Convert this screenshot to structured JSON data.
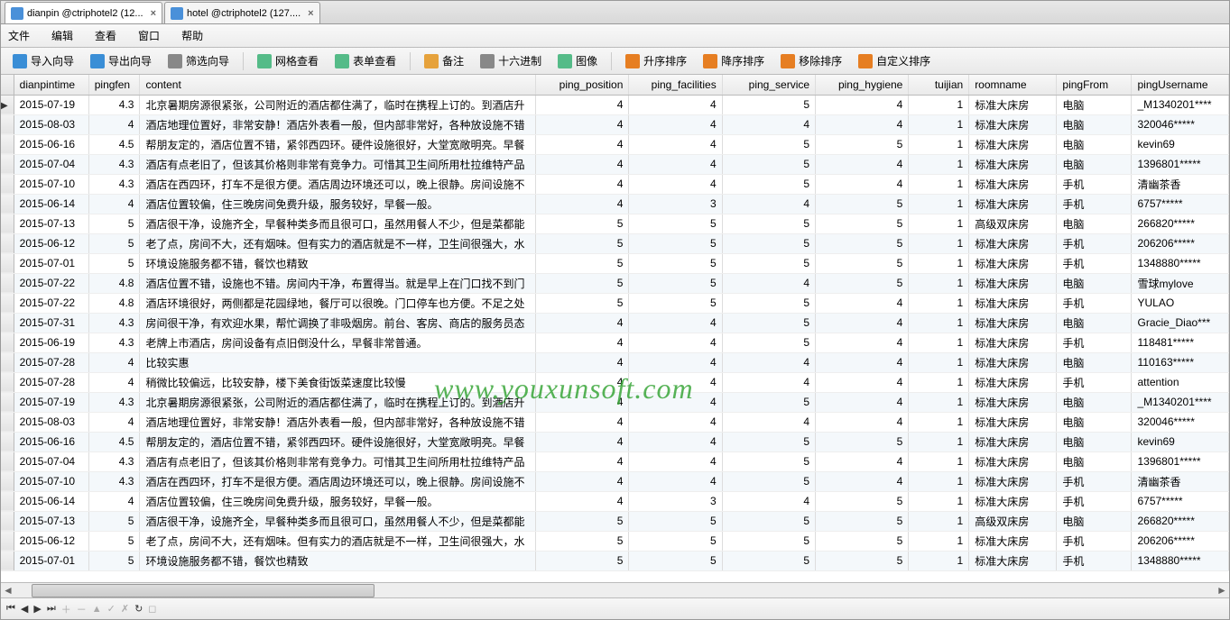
{
  "tabs": [
    {
      "label": "dianpin @ctriphotel2 (12...",
      "active": true
    },
    {
      "label": "hotel @ctriphotel2 (127....",
      "active": false
    }
  ],
  "menu": {
    "file": "文件",
    "edit": "编辑",
    "view": "查看",
    "window": "窗口",
    "help": "帮助"
  },
  "toolbar": {
    "import": "导入向导",
    "export": "导出向导",
    "filter": "筛选向导",
    "grid": "网格查看",
    "form": "表单查看",
    "memo": "备注",
    "hex": "十六进制",
    "image": "图像",
    "asc": "升序排序",
    "desc": "降序排序",
    "remove": "移除排序",
    "custom": "自定义排序"
  },
  "columns": {
    "dianpintime": "dianpintime",
    "pingfen": "pingfen",
    "content": "content",
    "ping_position": "ping_position",
    "ping_facilities": "ping_facilities",
    "ping_service": "ping_service",
    "ping_hygiene": "ping_hygiene",
    "tuijian": "tuijian",
    "roomname": "roomname",
    "pingFrom": "pingFrom",
    "pingUsername": "pingUsername"
  },
  "rows": [
    {
      "dianpintime": "2015-07-19",
      "pingfen": "4.3",
      "content": "北京暑期房源很紧张，公司附近的酒店都住满了，临时在携程上订的。到酒店升",
      "ping_position": "4",
      "ping_facilities": "4",
      "ping_service": "5",
      "ping_hygiene": "4",
      "tuijian": "1",
      "roomname": "标准大床房",
      "pingFrom": "电脑",
      "pingUsername": "_M1340201****"
    },
    {
      "dianpintime": "2015-08-03",
      "pingfen": "4",
      "content": "酒店地理位置好，非常安静！酒店外表看一般，但内部非常好，各种放设施不错",
      "ping_position": "4",
      "ping_facilities": "4",
      "ping_service": "4",
      "ping_hygiene": "4",
      "tuijian": "1",
      "roomname": "标准大床房",
      "pingFrom": "电脑",
      "pingUsername": "320046*****"
    },
    {
      "dianpintime": "2015-06-16",
      "pingfen": "4.5",
      "content": "帮朋友定的，酒店位置不错，紧邻西四环。硬件设施很好，大堂宽敞明亮。早餐",
      "ping_position": "4",
      "ping_facilities": "4",
      "ping_service": "5",
      "ping_hygiene": "5",
      "tuijian": "1",
      "roomname": "标准大床房",
      "pingFrom": "电脑",
      "pingUsername": "kevin69"
    },
    {
      "dianpintime": "2015-07-04",
      "pingfen": "4.3",
      "content": "酒店有点老旧了，但该其价格则非常有竞争力。可惜其卫生间所用杜拉维特产品",
      "ping_position": "4",
      "ping_facilities": "4",
      "ping_service": "5",
      "ping_hygiene": "4",
      "tuijian": "1",
      "roomname": "标准大床房",
      "pingFrom": "电脑",
      "pingUsername": "1396801*****"
    },
    {
      "dianpintime": "2015-07-10",
      "pingfen": "4.3",
      "content": "酒店在西四环，打车不是很方便。酒店周边环境还可以，晚上很静。房间设施不",
      "ping_position": "4",
      "ping_facilities": "4",
      "ping_service": "5",
      "ping_hygiene": "4",
      "tuijian": "1",
      "roomname": "标准大床房",
      "pingFrom": "手机",
      "pingUsername": "清幽茶香"
    },
    {
      "dianpintime": "2015-06-14",
      "pingfen": "4",
      "content": "酒店位置较偏，住三晚房间免费升级，服务较好，早餐一般。",
      "ping_position": "4",
      "ping_facilities": "3",
      "ping_service": "4",
      "ping_hygiene": "5",
      "tuijian": "1",
      "roomname": "标准大床房",
      "pingFrom": "手机",
      "pingUsername": "6757*****"
    },
    {
      "dianpintime": "2015-07-13",
      "pingfen": "5",
      "content": "酒店很干净，设施齐全，早餐种类多而且很可口，虽然用餐人不少，但是菜都能",
      "ping_position": "5",
      "ping_facilities": "5",
      "ping_service": "5",
      "ping_hygiene": "5",
      "tuijian": "1",
      "roomname": "高级双床房",
      "pingFrom": "电脑",
      "pingUsername": "266820*****"
    },
    {
      "dianpintime": "2015-06-12",
      "pingfen": "5",
      "content": "老了点，房间不大，还有烟味。但有实力的酒店就是不一样，卫生间很强大，水",
      "ping_position": "5",
      "ping_facilities": "5",
      "ping_service": "5",
      "ping_hygiene": "5",
      "tuijian": "1",
      "roomname": "标准大床房",
      "pingFrom": "手机",
      "pingUsername": "206206*****"
    },
    {
      "dianpintime": "2015-07-01",
      "pingfen": "5",
      "content": "环境设施服务都不错，餐饮也精致",
      "ping_position": "5",
      "ping_facilities": "5",
      "ping_service": "5",
      "ping_hygiene": "5",
      "tuijian": "1",
      "roomname": "标准大床房",
      "pingFrom": "手机",
      "pingUsername": "1348880*****"
    },
    {
      "dianpintime": "2015-07-22",
      "pingfen": "4.8",
      "content": "酒店位置不错，设施也不错。房间内干净，布置得当。就是早上在门口找不到门",
      "ping_position": "5",
      "ping_facilities": "5",
      "ping_service": "4",
      "ping_hygiene": "5",
      "tuijian": "1",
      "roomname": "标准大床房",
      "pingFrom": "电脑",
      "pingUsername": "雪球mylove"
    },
    {
      "dianpintime": "2015-07-22",
      "pingfen": "4.8",
      "content": "酒店环境很好，两侧都是花园绿地，餐厅可以很晚。门口停车也方便。不足之处",
      "ping_position": "5",
      "ping_facilities": "5",
      "ping_service": "5",
      "ping_hygiene": "4",
      "tuijian": "1",
      "roomname": "标准大床房",
      "pingFrom": "手机",
      "pingUsername": "YULAO"
    },
    {
      "dianpintime": "2015-07-31",
      "pingfen": "4.3",
      "content": "房间很干净，有欢迎水果，帮忙调换了非吸烟房。前台、客房、商店的服务员态",
      "ping_position": "4",
      "ping_facilities": "4",
      "ping_service": "5",
      "ping_hygiene": "4",
      "tuijian": "1",
      "roomname": "标准大床房",
      "pingFrom": "电脑",
      "pingUsername": "Gracie_Diao***"
    },
    {
      "dianpintime": "2015-06-19",
      "pingfen": "4.3",
      "content": "老牌上市酒店，房间设备有点旧倒没什么，早餐非常普通。",
      "ping_position": "4",
      "ping_facilities": "4",
      "ping_service": "5",
      "ping_hygiene": "4",
      "tuijian": "1",
      "roomname": "标准大床房",
      "pingFrom": "手机",
      "pingUsername": "118481*****"
    },
    {
      "dianpintime": "2015-07-28",
      "pingfen": "4",
      "content": "比较实惠",
      "ping_position": "4",
      "ping_facilities": "4",
      "ping_service": "4",
      "ping_hygiene": "4",
      "tuijian": "1",
      "roomname": "标准大床房",
      "pingFrom": "电脑",
      "pingUsername": "110163*****"
    },
    {
      "dianpintime": "2015-07-28",
      "pingfen": "4",
      "content": "稍微比较偏远，比较安静，楼下美食街饭菜速度比较慢",
      "ping_position": "4",
      "ping_facilities": "4",
      "ping_service": "4",
      "ping_hygiene": "4",
      "tuijian": "1",
      "roomname": "标准大床房",
      "pingFrom": "手机",
      "pingUsername": "attention"
    },
    {
      "dianpintime": "2015-07-19",
      "pingfen": "4.3",
      "content": "北京暑期房源很紧张，公司附近的酒店都住满了，临时在携程上订的。到酒店升",
      "ping_position": "4",
      "ping_facilities": "4",
      "ping_service": "5",
      "ping_hygiene": "4",
      "tuijian": "1",
      "roomname": "标准大床房",
      "pingFrom": "电脑",
      "pingUsername": "_M1340201****"
    },
    {
      "dianpintime": "2015-08-03",
      "pingfen": "4",
      "content": "酒店地理位置好，非常安静！酒店外表看一般，但内部非常好，各种放设施不错",
      "ping_position": "4",
      "ping_facilities": "4",
      "ping_service": "4",
      "ping_hygiene": "4",
      "tuijian": "1",
      "roomname": "标准大床房",
      "pingFrom": "电脑",
      "pingUsername": "320046*****"
    },
    {
      "dianpintime": "2015-06-16",
      "pingfen": "4.5",
      "content": "帮朋友定的，酒店位置不错，紧邻西四环。硬件设施很好，大堂宽敞明亮。早餐",
      "ping_position": "4",
      "ping_facilities": "4",
      "ping_service": "5",
      "ping_hygiene": "5",
      "tuijian": "1",
      "roomname": "标准大床房",
      "pingFrom": "电脑",
      "pingUsername": "kevin69"
    },
    {
      "dianpintime": "2015-07-04",
      "pingfen": "4.3",
      "content": "酒店有点老旧了，但该其价格则非常有竞争力。可惜其卫生间所用杜拉维特产品",
      "ping_position": "4",
      "ping_facilities": "4",
      "ping_service": "5",
      "ping_hygiene": "4",
      "tuijian": "1",
      "roomname": "标准大床房",
      "pingFrom": "电脑",
      "pingUsername": "1396801*****"
    },
    {
      "dianpintime": "2015-07-10",
      "pingfen": "4.3",
      "content": "酒店在西四环，打车不是很方便。酒店周边环境还可以，晚上很静。房间设施不",
      "ping_position": "4",
      "ping_facilities": "4",
      "ping_service": "5",
      "ping_hygiene": "4",
      "tuijian": "1",
      "roomname": "标准大床房",
      "pingFrom": "手机",
      "pingUsername": "清幽茶香"
    },
    {
      "dianpintime": "2015-06-14",
      "pingfen": "4",
      "content": "酒店位置较偏，住三晚房间免费升级，服务较好，早餐一般。",
      "ping_position": "4",
      "ping_facilities": "3",
      "ping_service": "4",
      "ping_hygiene": "5",
      "tuijian": "1",
      "roomname": "标准大床房",
      "pingFrom": "手机",
      "pingUsername": "6757*****"
    },
    {
      "dianpintime": "2015-07-13",
      "pingfen": "5",
      "content": "酒店很干净，设施齐全，早餐种类多而且很可口，虽然用餐人不少，但是菜都能",
      "ping_position": "5",
      "ping_facilities": "5",
      "ping_service": "5",
      "ping_hygiene": "5",
      "tuijian": "1",
      "roomname": "高级双床房",
      "pingFrom": "电脑",
      "pingUsername": "266820*****"
    },
    {
      "dianpintime": "2015-06-12",
      "pingfen": "5",
      "content": "老了点，房间不大，还有烟味。但有实力的酒店就是不一样，卫生间很强大，水",
      "ping_position": "5",
      "ping_facilities": "5",
      "ping_service": "5",
      "ping_hygiene": "5",
      "tuijian": "1",
      "roomname": "标准大床房",
      "pingFrom": "手机",
      "pingUsername": "206206*****"
    },
    {
      "dianpintime": "2015-07-01",
      "pingfen": "5",
      "content": "环境设施服务都不错，餐饮也精致",
      "ping_position": "5",
      "ping_facilities": "5",
      "ping_service": "5",
      "ping_hygiene": "5",
      "tuijian": "1",
      "roomname": "标准大床房",
      "pingFrom": "手机",
      "pingUsername": "1348880*****"
    }
  ],
  "watermark": "www.youxunsoft.com",
  "icon_colors": {
    "import": "#3a8ed6",
    "export": "#3a8ed6",
    "filter": "#888",
    "grid": "#5b8",
    "form": "#5b8",
    "memo": "#e6a23c",
    "hex": "#888",
    "image": "#5b8",
    "asc": "#e67e22",
    "desc": "#e67e22",
    "remove": "#e67e22",
    "custom": "#e67e22"
  }
}
